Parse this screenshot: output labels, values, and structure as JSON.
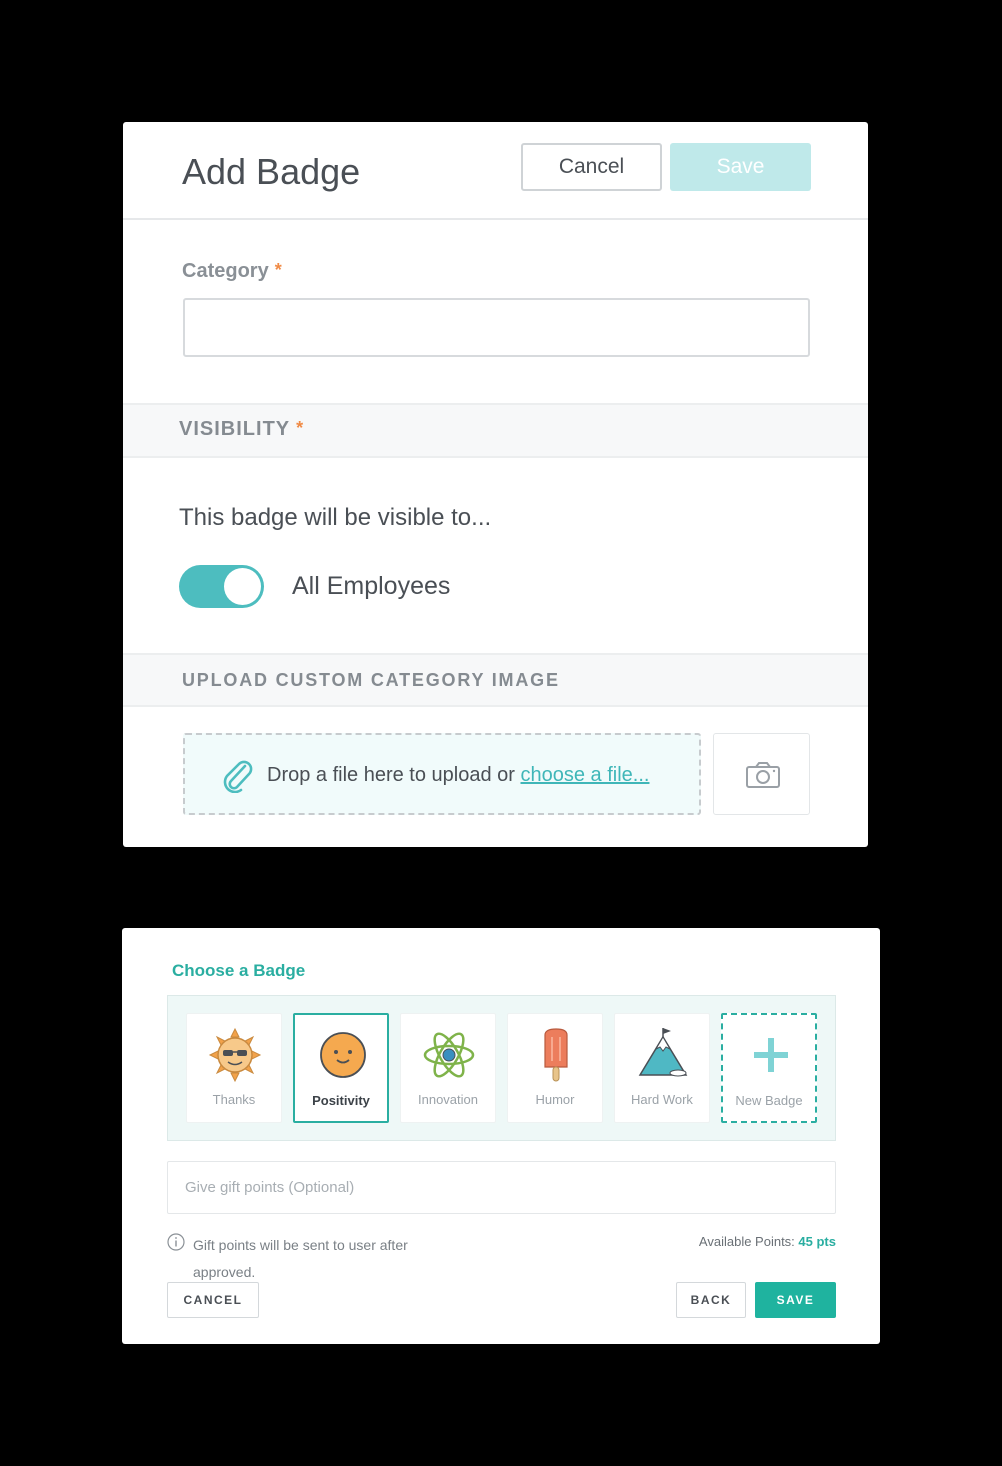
{
  "add_badge": {
    "title": "Add Badge",
    "cancel_label": "Cancel",
    "save_label": "Save",
    "category_label": "Category",
    "required_mark": "*",
    "category_value": "",
    "visibility_label": "VISIBILITY",
    "visibility_text": "This badge will be visible to...",
    "toggle_label": "All Employees",
    "toggle_on": true,
    "upload_label": "UPLOAD CUSTOM CATEGORY IMAGE",
    "drop_text": "Drop a file here to upload or ",
    "drop_link": "choose a file...",
    "colors": {
      "accent": "#4dbdbf",
      "save_disabled": "#bfe9ea",
      "required": "#f08a45"
    }
  },
  "choose_badge": {
    "title": "Choose a Badge",
    "badges": [
      {
        "label": "Thanks",
        "icon": "sun-sunglasses-icon",
        "selected": false
      },
      {
        "label": "Positivity",
        "icon": "smiley-face-icon",
        "selected": true
      },
      {
        "label": "Innovation",
        "icon": "atom-icon",
        "selected": false
      },
      {
        "label": "Humor",
        "icon": "popsicle-icon",
        "selected": false
      },
      {
        "label": "Hard Work",
        "icon": "mountain-flag-icon",
        "selected": false
      },
      {
        "label": "New Badge",
        "icon": "plus-icon",
        "selected": false
      }
    ],
    "gift_placeholder": "Give gift points (Optional)",
    "gift_note": "Gift points will be sent to user after approved.",
    "available_label": "Available Points: ",
    "available_value": "45 pts",
    "cancel_label": "CANCEL",
    "back_label": "BACK",
    "save_label": "SAVE",
    "colors": {
      "accent": "#2aaea1",
      "save": "#1fb39f"
    }
  }
}
